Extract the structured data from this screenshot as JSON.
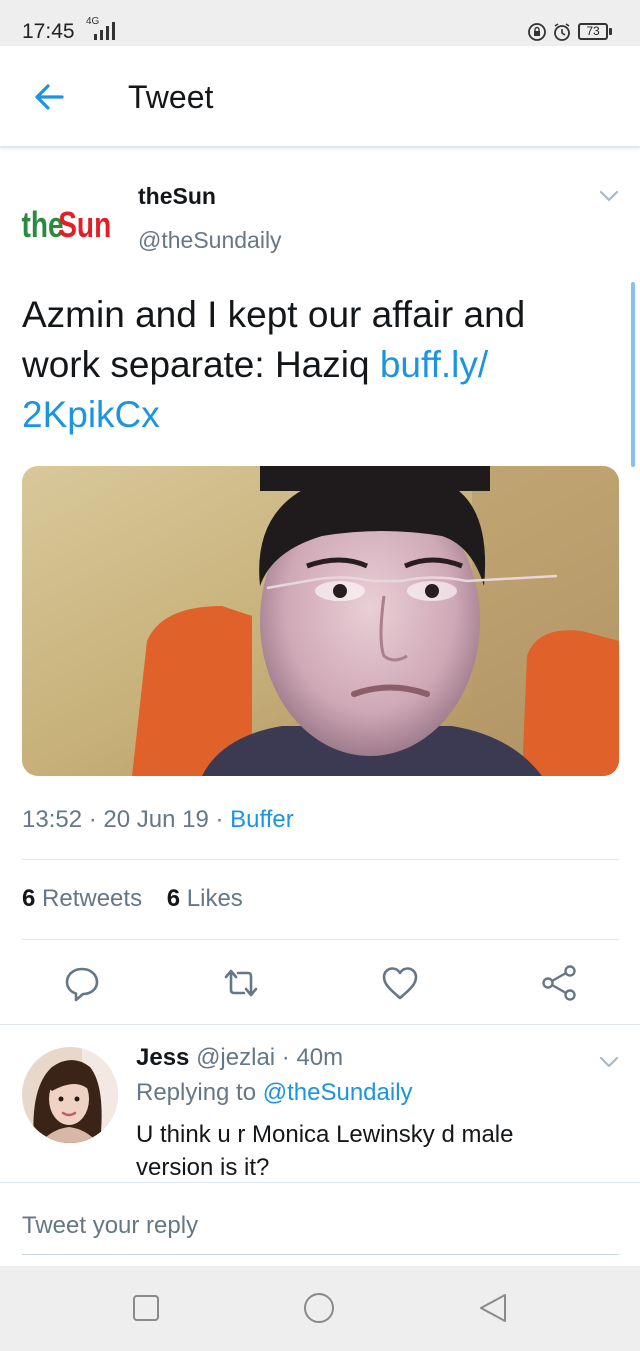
{
  "status_bar": {
    "time": "17:45",
    "network": "4G",
    "battery": "73"
  },
  "header": {
    "title": "Tweet"
  },
  "tweet": {
    "author_name": "theSun",
    "author_handle": "@theSundaily",
    "logo_text": "theSun",
    "text": "Azmin and I kept our affair and work separate: Haziq ",
    "link": "buff.ly/ 2KpikCx",
    "time": "13:52",
    "date": "20 Jun 19",
    "separator": "·",
    "via": "Buffer",
    "retweets_count": "6",
    "retweets_label": "Retweets",
    "likes_count": "6",
    "likes_label": "Likes"
  },
  "reply": {
    "name": "Jess",
    "handle": "@jezlai",
    "age": "· 40m",
    "replying_label": "Replying to",
    "replying_handle": "@theSundaily",
    "text": "U think u r Monica Lewinsky d male version is it?"
  },
  "compose": {
    "placeholder": "Tweet your reply"
  },
  "colors": {
    "accent": "#1b95e0",
    "secondary_text": "#657786",
    "logo_red": "#e31e24",
    "logo_green": "#2a8a3e"
  }
}
